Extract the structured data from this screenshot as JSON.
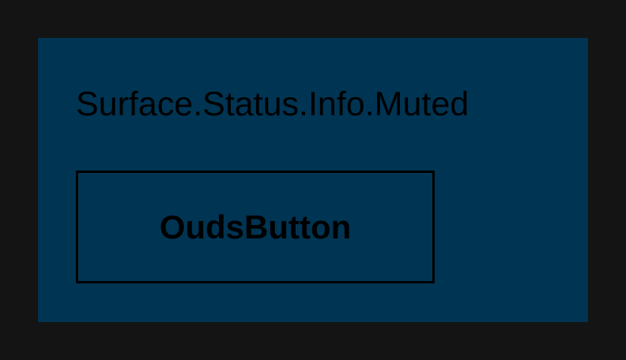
{
  "colors": {
    "background": "#141414",
    "surface": "#003453",
    "content": "#000000"
  },
  "surface": {
    "title": "Surface.Status.Info.Muted"
  },
  "button": {
    "label": "OudsButton"
  }
}
